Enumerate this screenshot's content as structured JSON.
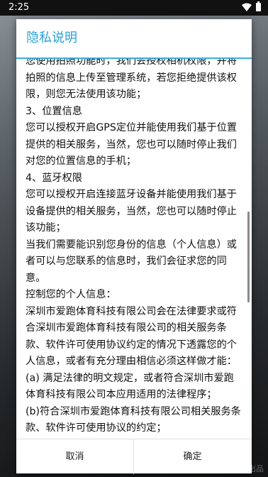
{
  "statusbar": {
    "time": "2:25",
    "wifi_icon": "wifi-icon",
    "battery_icon": "battery-icon"
  },
  "dialog": {
    "title": "隐私说明",
    "paragraphs": [
      "您使用拍照功能时，我们会授权相机权限，并将拍照的信息上传至管理系统，若您拒绝提供该权限，则您无法使用该功能；",
      "3、位置信息",
      "您可以授权开启GPS定位并能使用我们基于位置提供的相关服务，当然，您也可以随时停止我们对您的位置信息的手机；",
      "4、蓝牙权限",
      "您可以授权开启连接蓝牙设备并能使用我们基于设备提供的相关服务，当然，您也可以随时停止该功能；",
      "当我们需要能识别您身份的信息（个人信息）或者可以与您联系的信息时，我们会征求您的同意。",
      "控制您的个人信息：",
      "深圳市爱跑体育科技有限公司会在法律要求或符合深圳市爱跑体育科技有限公司的相关服务条款、软件许可使用协议约定的情况下透露您的个人信息，或者有充分理由相信必须这样做才能：",
      "(a) 满足法律的明文规定，或者符合深圳市爱跑体育科技有限公司本应用适用的法律程序；",
      "(b)符合深圳市爱跑体育科技有限公司相关服务条款、软件许可使用协议的约定；"
    ],
    "cancel_label": "取消",
    "confirm_label": "确定"
  },
  "colors": {
    "accent": "#29a3d6",
    "divider": "#3aaee0"
  },
  "watermark": "出品"
}
